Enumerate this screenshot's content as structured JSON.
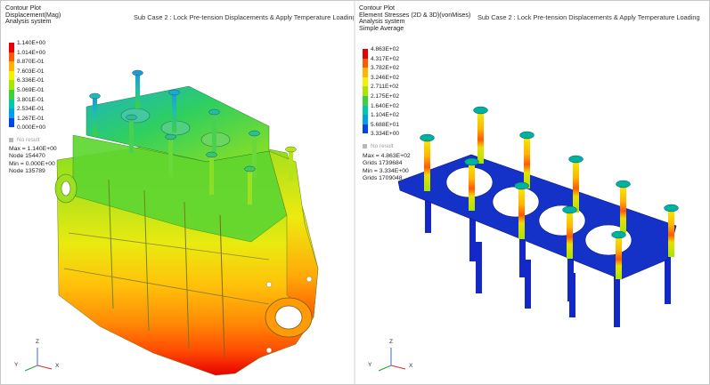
{
  "left_plot": {
    "header": [
      "Contour Plot",
      "Displacement(Mag)",
      "Analysis system"
    ],
    "subcase": "Sub Case 2 : Lock Pre-tension Displacements  &  Apply Temperature Loading",
    "legend_values": [
      "1.140E+00",
      "1.014E+00",
      "8.870E-01",
      "7.603E-01",
      "6.336E-01",
      "5.069E-01",
      "3.801E-01",
      "2.534E-01",
      "1.267E-01",
      "0.000E+00"
    ],
    "no_result": "No result",
    "stats": [
      "Max = 1.140E+00",
      "Node 154470",
      "Min = 0.000E+00",
      "Node 135789"
    ],
    "triad": {
      "x": "X",
      "y": "Y",
      "z": "Z"
    }
  },
  "right_plot": {
    "header": [
      "Contour Plot",
      "Element Stresses (2D & 3D)(vonMises)",
      "Analysis system",
      "Simple Average"
    ],
    "subcase": "Sub Case 2 : Lock Pre-tension Displacements  &  Apply Temperature Loading",
    "legend_values": [
      "4.863E+02",
      "4.317E+02",
      "3.782E+02",
      "3.246E+02",
      "2.711E+02",
      "2.175E+02",
      "1.640E+02",
      "1.104E+02",
      "5.688E+01",
      "3.334E+00"
    ],
    "no_result": "No result",
    "stats": [
      "Max = 4.863E+02",
      "Grids 1739684",
      "Min = 3.334E+00",
      "Grids 1709048"
    ],
    "triad": {
      "x": "X",
      "y": "Y",
      "z": "Z"
    }
  },
  "legend_colors": [
    "#e80000",
    "#ff5a00",
    "#ffb400",
    "#f2f200",
    "#a6e600",
    "#3dd23d",
    "#00c8aa",
    "#00a0e6",
    "#0046e6",
    "#1414b4"
  ]
}
